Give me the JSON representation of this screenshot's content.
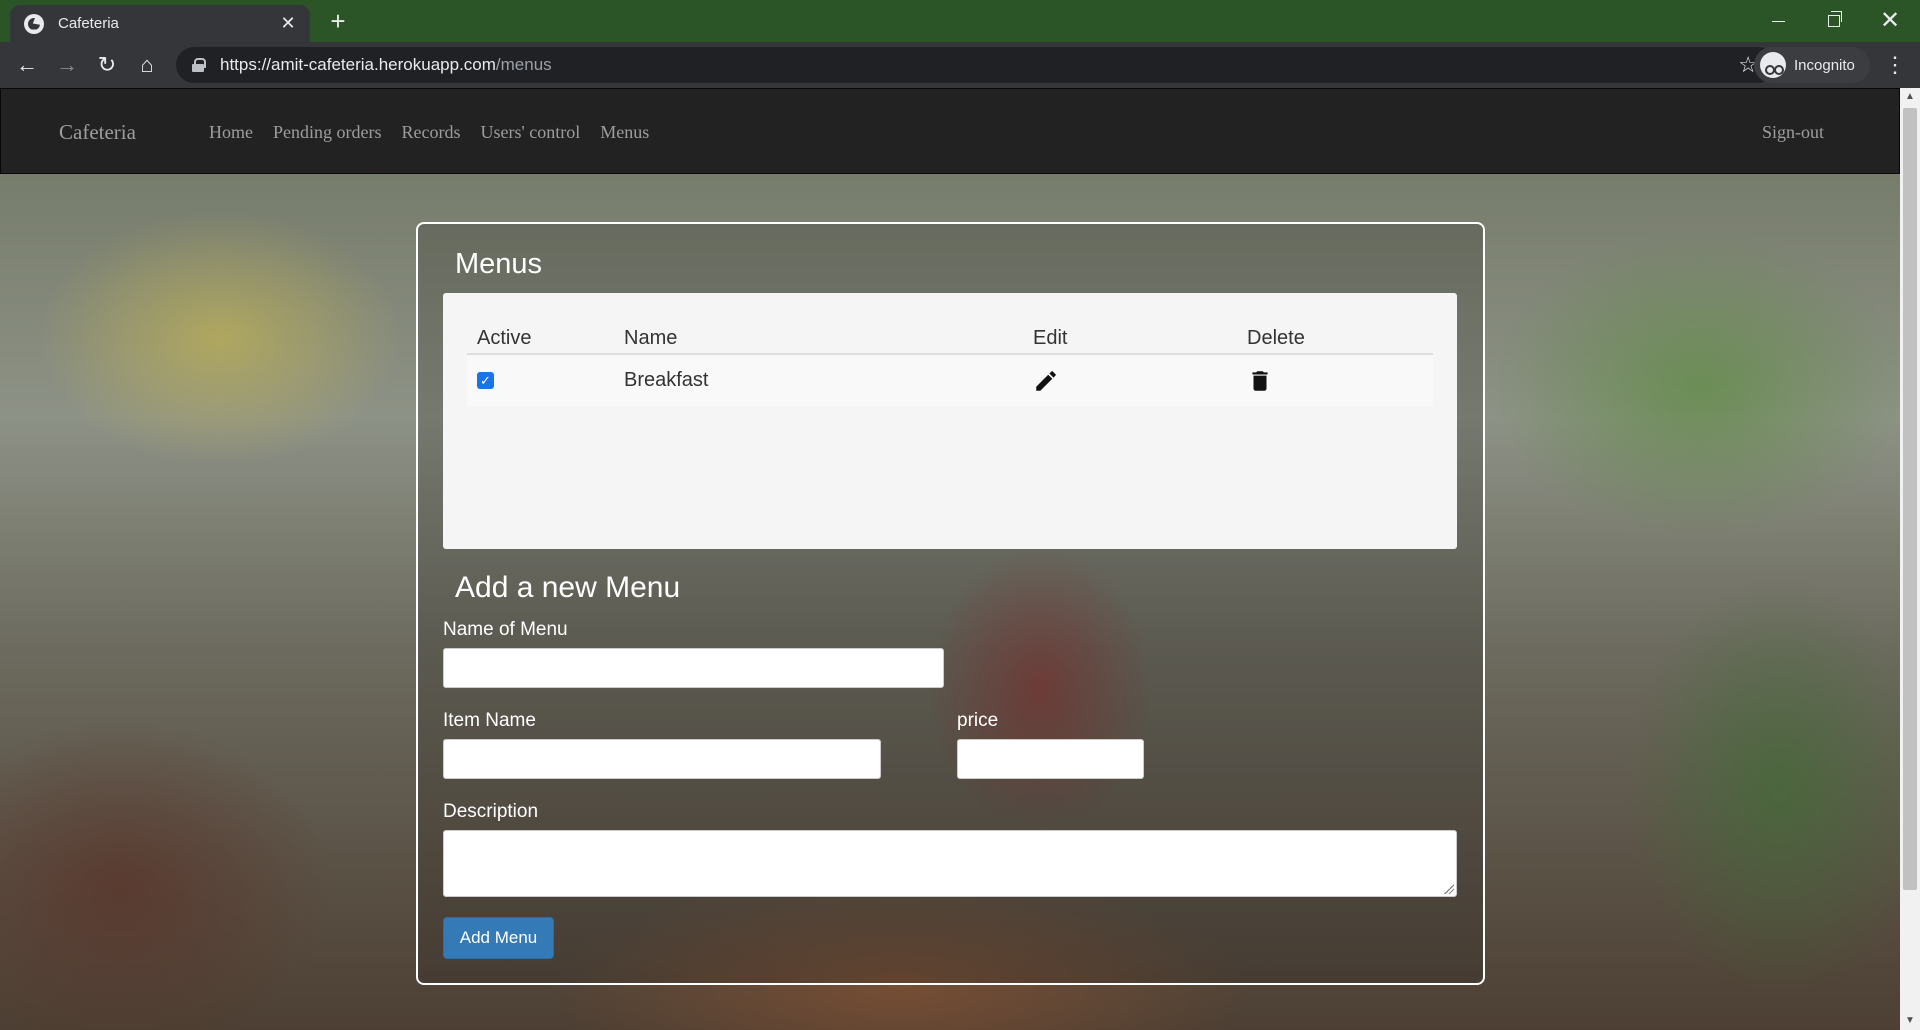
{
  "browser": {
    "tab_title": "Cafeteria",
    "url_host": "https://amit-cafeteria.herokuapp.com",
    "url_path": "/menus",
    "profile_label": "Incognito"
  },
  "site": {
    "brand": "Cafeteria",
    "nav": [
      {
        "label": "Home"
      },
      {
        "label": "Pending orders"
      },
      {
        "label": "Records"
      },
      {
        "label": "Users' control"
      },
      {
        "label": "Menus"
      }
    ],
    "signout": "Sign-out"
  },
  "menus": {
    "title": "Menus",
    "columns": {
      "active": "Active",
      "name": "Name",
      "edit": "Edit",
      "delete": "Delete"
    },
    "rows": [
      {
        "active": true,
        "name": "Breakfast"
      }
    ]
  },
  "form": {
    "title": "Add a new Menu",
    "menu_name_label": "Name of Menu",
    "menu_name_value": "",
    "item_name_label": "Item Name",
    "item_name_value": "",
    "price_label": "price",
    "price_value": "",
    "description_label": "Description",
    "description_value": "",
    "submit_label": "Add Menu"
  },
  "colors": {
    "navbar": "#222222",
    "primary_button": "#337ab7",
    "tabstrip": "#2b5427"
  }
}
